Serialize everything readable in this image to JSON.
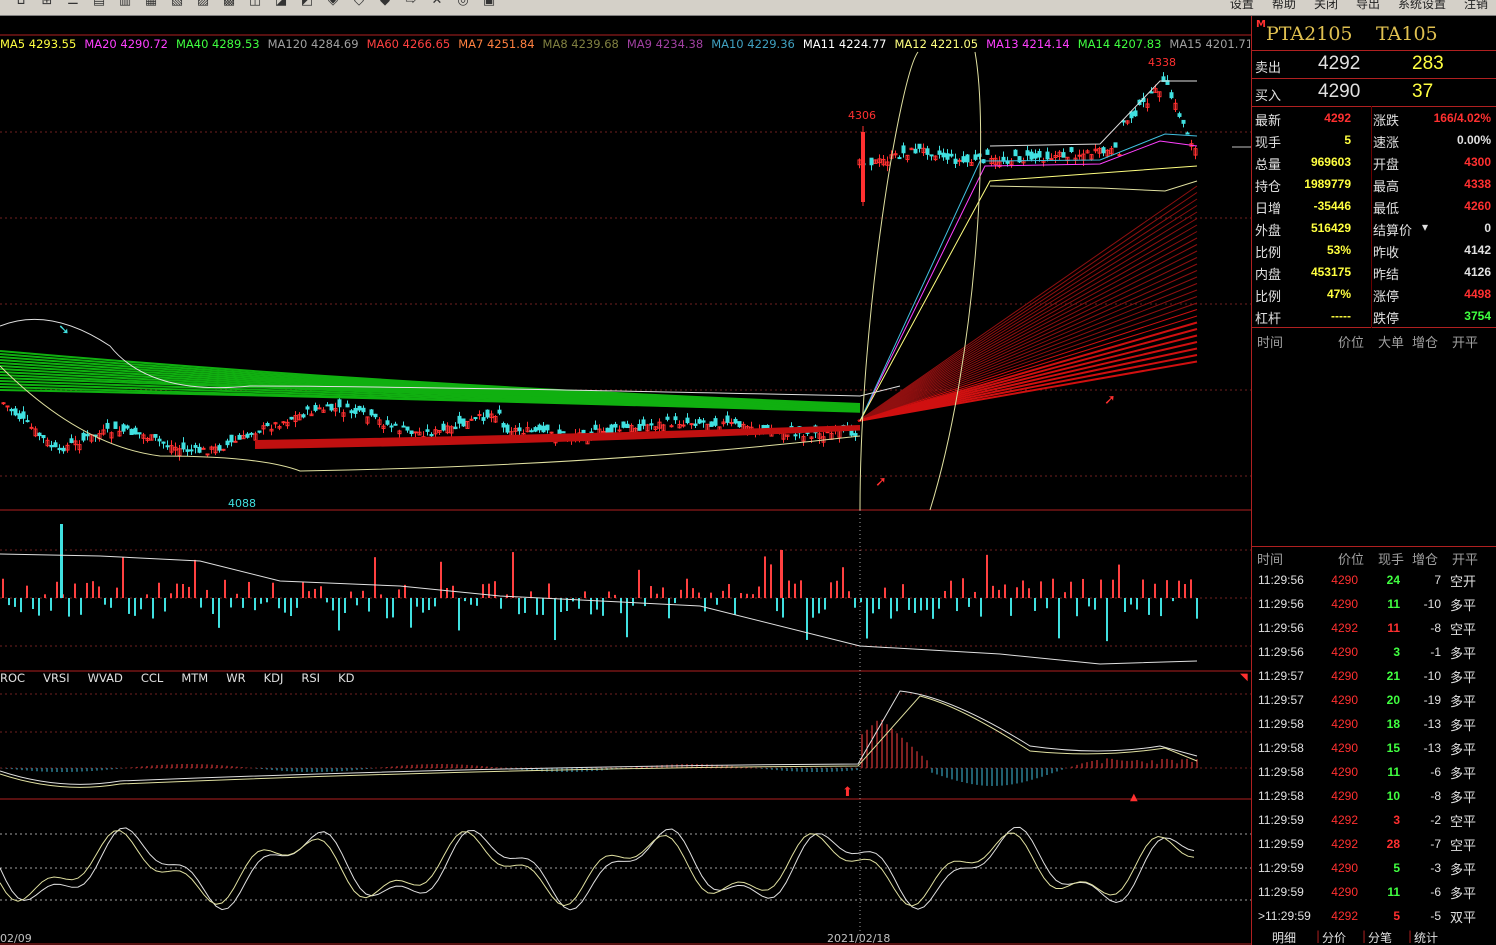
{
  "topbar": {
    "right_items": [
      "设置",
      "帮助",
      "关闭",
      "导出",
      "系统设置",
      "注销"
    ]
  },
  "legend": [
    {
      "label": "MA5 4293.55",
      "color": "#ffff40"
    },
    {
      "label": "MA20 4290.72",
      "color": "#ff40ff"
    },
    {
      "label": "MA40 4289.53",
      "color": "#40ff40"
    },
    {
      "label": "MA120 4284.69",
      "color": "#a0a0a0"
    },
    {
      "label": "MA60 4266.65",
      "color": "#ff4040"
    },
    {
      "label": "MA7 4251.84",
      "color": "#ff8040"
    },
    {
      "label": "MA8 4239.68",
      "color": "#808040"
    },
    {
      "label": "MA9 4234.38",
      "color": "#a040a0"
    },
    {
      "label": "MA10 4229.36",
      "color": "#40a0c0"
    },
    {
      "label": "MA11 4224.77",
      "color": "#ffffff"
    },
    {
      "label": "MA12 4221.05",
      "color": "#ffff80"
    },
    {
      "label": "MA13 4214.14",
      "color": "#ff40ff"
    },
    {
      "label": "MA14 4207.83",
      "color": "#40ff40"
    },
    {
      "label": "MA15 4201.71",
      "color": "#a0a0a0"
    }
  ],
  "chart_data": {
    "type": "candlestick",
    "price_labels": {
      "high": "4338",
      "peak_gap": "4306",
      "low": "4088"
    },
    "x_labels": [
      "02/09",
      "2021/02/18"
    ],
    "indicator_tabs": [
      "ROC",
      "VRSI",
      "WVAD",
      "CCL",
      "MTM",
      "WR",
      "KDJ",
      "RSI",
      "KD"
    ]
  },
  "quote": {
    "code": "PTA2105",
    "sub_code": "TA105",
    "sell_label": "卖出",
    "sell_price": "4292",
    "sell_vol": "283",
    "buy_label": "买入",
    "buy_price": "4290",
    "buy_vol": "37",
    "stats": [
      {
        "l1": "最新",
        "v1": "4292",
        "c1": "#ff3030",
        "l2": "涨跌",
        "v2": "166/4.02%",
        "c2": "#ff3030"
      },
      {
        "l1": "现手",
        "v1": "5",
        "c1": "#ffff40",
        "l2": "速涨",
        "v2": "0.00%",
        "c2": "#e0e0e0"
      },
      {
        "l1": "总量",
        "v1": "969603",
        "c1": "#ffff40",
        "l2": "开盘",
        "v2": "4300",
        "c2": "#ff3030"
      },
      {
        "l1": "持仓",
        "v1": "1989779",
        "c1": "#ffff40",
        "l2": "最高",
        "v2": "4338",
        "c2": "#ff3030"
      },
      {
        "l1": "日增",
        "v1": "-35446",
        "c1": "#ffff40",
        "l2": "最低",
        "v2": "4260",
        "c2": "#ff3030"
      },
      {
        "l1": "外盘",
        "v1": "516429",
        "c1": "#ffff40",
        "l2": "结算价",
        "v2": "0",
        "c2": "#e0e0e0"
      },
      {
        "l1": "比例",
        "v1": "53%",
        "c1": "#ffff40",
        "l2": "昨收",
        "v2": "4142",
        "c2": "#e0e0e0"
      },
      {
        "l1": "内盘",
        "v1": "453175",
        "c1": "#ffff40",
        "l2": "昨结",
        "v2": "4126",
        "c2": "#e0e0e0"
      },
      {
        "l1": "比例",
        "v1": "47%",
        "c1": "#ffff40",
        "l2": "涨停",
        "v2": "4498",
        "c2": "#ff3030"
      },
      {
        "l1": "杠杆",
        "v1": "-----",
        "c1": "#ffff40",
        "l2": "跌停",
        "v2": "3754",
        "c2": "#40ff40"
      }
    ],
    "settle_arrow": "▾"
  },
  "big_order_header": {
    "time": "时间",
    "price": "价位",
    "big": "大单",
    "oi": "增仓",
    "kind": "开平"
  },
  "trades_header": {
    "time": "时间",
    "price": "价位",
    "vol": "现手",
    "oi": "增仓",
    "kind": "开平"
  },
  "trades": [
    {
      "t": "11:29:56",
      "p": "4290",
      "q": "24",
      "qc": "#40ff40",
      "d": "7",
      "k": "空开"
    },
    {
      "t": "11:29:56",
      "p": "4290",
      "q": "11",
      "qc": "#40ff40",
      "d": "-10",
      "k": "多平"
    },
    {
      "t": "11:29:56",
      "p": "4292",
      "q": "11",
      "qc": "#ff3030",
      "d": "-8",
      "k": "空平"
    },
    {
      "t": "11:29:56",
      "p": "4290",
      "q": "3",
      "qc": "#40ff40",
      "d": "-1",
      "k": "多平"
    },
    {
      "t": "11:29:57",
      "p": "4290",
      "q": "21",
      "qc": "#40ff40",
      "d": "-10",
      "k": "多平"
    },
    {
      "t": "11:29:57",
      "p": "4290",
      "q": "20",
      "qc": "#40ff40",
      "d": "-19",
      "k": "多平"
    },
    {
      "t": "11:29:58",
      "p": "4290",
      "q": "18",
      "qc": "#40ff40",
      "d": "-13",
      "k": "多平"
    },
    {
      "t": "11:29:58",
      "p": "4290",
      "q": "15",
      "qc": "#40ff40",
      "d": "-13",
      "k": "多平"
    },
    {
      "t": "11:29:58",
      "p": "4290",
      "q": "11",
      "qc": "#40ff40",
      "d": "-6",
      "k": "多平"
    },
    {
      "t": "11:29:58",
      "p": "4290",
      "q": "10",
      "qc": "#40ff40",
      "d": "-8",
      "k": "多平"
    },
    {
      "t": "11:29:59",
      "p": "4292",
      "q": "3",
      "qc": "#ff3030",
      "d": "-2",
      "k": "空平"
    },
    {
      "t": "11:29:59",
      "p": "4292",
      "q": "28",
      "qc": "#ff3030",
      "d": "-7",
      "k": "空平"
    },
    {
      "t": "11:29:59",
      "p": "4290",
      "q": "5",
      "qc": "#40ff40",
      "d": "-3",
      "k": "多平"
    },
    {
      "t": "11:29:59",
      "p": "4290",
      "q": "11",
      "qc": "#40ff40",
      "d": "-6",
      "k": "多平"
    },
    {
      "t": ">11:29:59",
      "p": "4292",
      "q": "5",
      "qc": "#ff3030",
      "d": "-5",
      "k": "双平"
    }
  ],
  "bottom_tabs": [
    "明细",
    "分价",
    "分笔",
    "统计"
  ]
}
